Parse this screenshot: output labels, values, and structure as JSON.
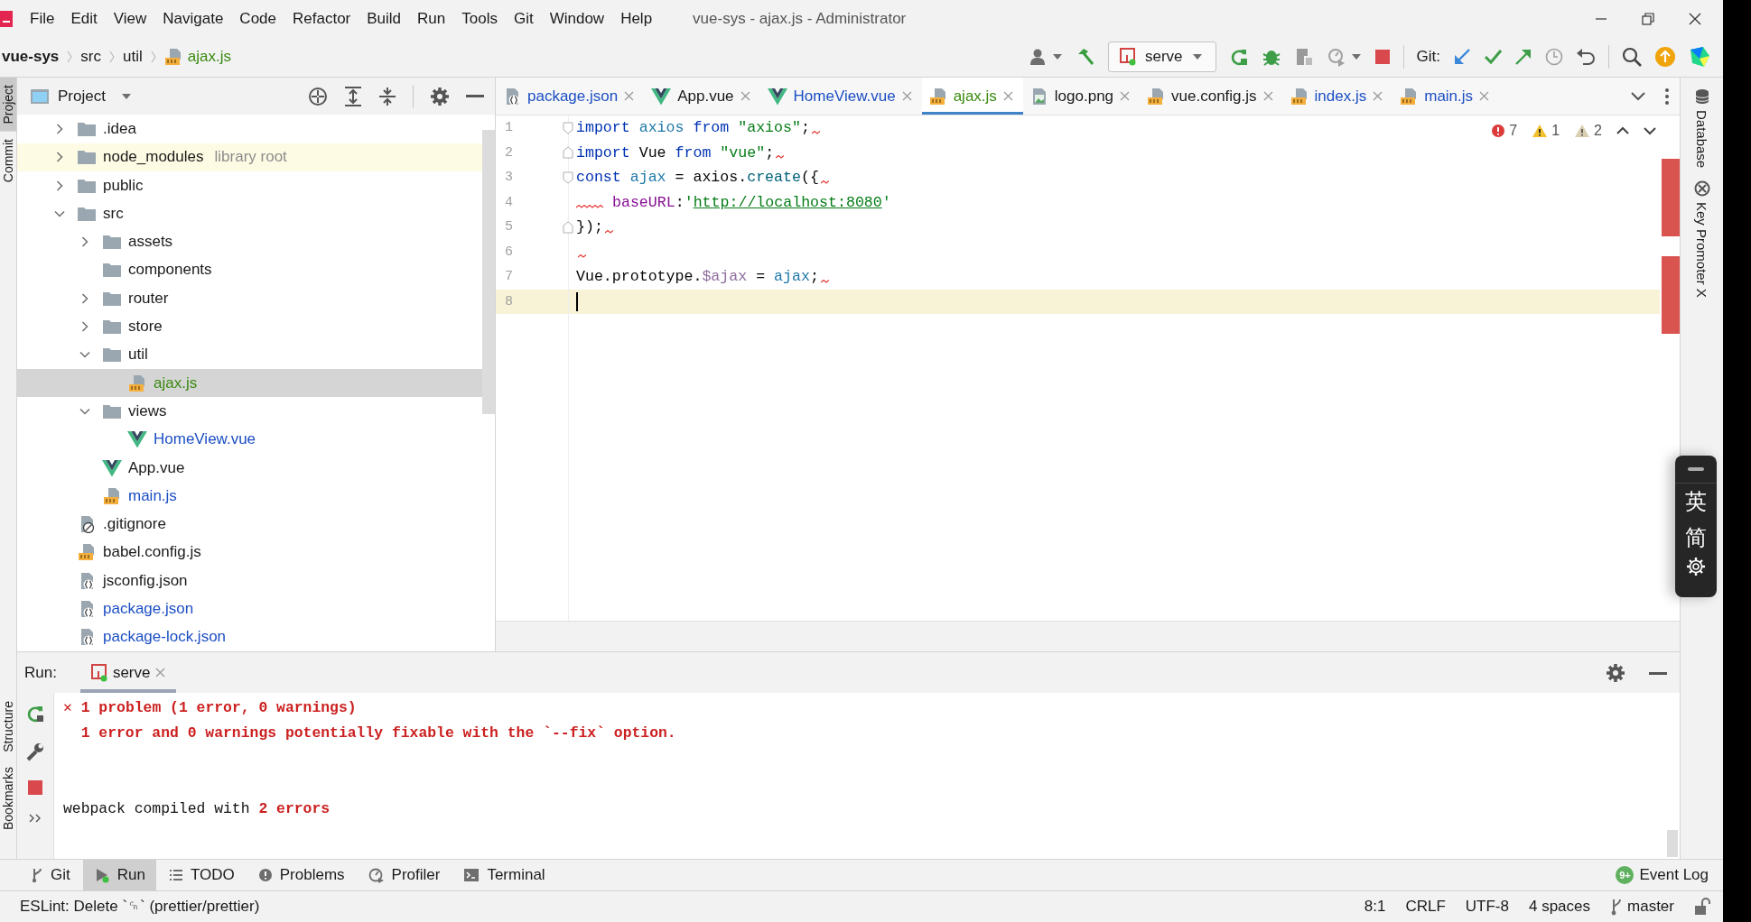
{
  "window": {
    "title": "vue-sys - ajax.js - Administrator"
  },
  "menu": [
    "File",
    "Edit",
    "View",
    "Navigate",
    "Code",
    "Refactor",
    "Build",
    "Run",
    "Tools",
    "Git",
    "Window",
    "Help"
  ],
  "breadcrumbs": [
    {
      "label": "vue-sys",
      "kind": "project"
    },
    {
      "label": "src",
      "kind": "folder"
    },
    {
      "label": "util",
      "kind": "folder"
    },
    {
      "label": "ajax.js",
      "kind": "js"
    }
  ],
  "toolbar": {
    "run_config": "serve",
    "git_label": "Git:"
  },
  "side_left": [
    {
      "label": "Project",
      "selected": true
    },
    {
      "label": "Commit",
      "selected": false
    },
    {
      "label": "Structure",
      "selected": false
    },
    {
      "label": "Bookmarks",
      "selected": false
    }
  ],
  "project_panel": {
    "title": "Project",
    "tree": [
      {
        "label": ".idea",
        "kind": "folder",
        "color": "#1a1a1a",
        "expanded": false,
        "selected": false
      },
      {
        "label": "node_modules",
        "hint": "library root",
        "kind": "library",
        "color": "#1a1a1a",
        "expanded": false,
        "selected": false
      },
      {
        "label": "public",
        "kind": "folder",
        "color": "#1a1a1a",
        "expanded": false,
        "selected": false
      },
      {
        "label": "src",
        "kind": "folder",
        "color": "#1a1a1a",
        "expanded": true,
        "selected": false,
        "children": [
          {
            "label": "assets",
            "kind": "folder",
            "color": "#1a1a1a",
            "expanded": false,
            "selected": false
          },
          {
            "label": "components",
            "kind": "folder",
            "color": "#1a1a1a",
            "selected": false
          },
          {
            "label": "router",
            "kind": "folder",
            "color": "#1a1a1a",
            "expanded": false,
            "selected": false
          },
          {
            "label": "store",
            "kind": "folder",
            "color": "#1a1a1a",
            "expanded": false,
            "selected": false
          },
          {
            "label": "util",
            "kind": "folder",
            "color": "#1a1a1a",
            "expanded": true,
            "selected": false,
            "children": [
              {
                "label": "ajax.js",
                "kind": "js",
                "color": "#3b8a12",
                "selected": true
              }
            ]
          },
          {
            "label": "views",
            "kind": "folder",
            "color": "#1a1a1a",
            "expanded": true,
            "selected": false,
            "children": [
              {
                "label": "HomeView.vue",
                "kind": "vue",
                "color": "#1c4fc4",
                "selected": false
              }
            ]
          },
          {
            "label": "App.vue",
            "kind": "vue",
            "color": "#1a1a1a",
            "selected": false
          },
          {
            "label": "main.js",
            "kind": "js",
            "color": "#1c4fc4",
            "selected": false
          }
        ]
      },
      {
        "label": ".gitignore",
        "kind": "ignore",
        "color": "#1a1a1a",
        "selected": false
      },
      {
        "label": "babel.config.js",
        "kind": "js",
        "color": "#1a1a1a",
        "selected": false
      },
      {
        "label": "jsconfig.json",
        "kind": "json",
        "color": "#1a1a1a",
        "selected": false
      },
      {
        "label": "package.json",
        "kind": "json",
        "color": "#1c4fc4",
        "selected": false
      },
      {
        "label": "package-lock.json",
        "kind": "json",
        "color": "#1c4fc4",
        "selected": false
      }
    ]
  },
  "editor": {
    "tabs": [
      {
        "label": "package.json",
        "kind": "json",
        "color": "#1c4fc4",
        "selected": false
      },
      {
        "label": "App.vue",
        "kind": "vue",
        "color": "#1a1a1a",
        "selected": false
      },
      {
        "label": "HomeView.vue",
        "kind": "vue",
        "color": "#1c4fc4",
        "selected": false
      },
      {
        "label": "ajax.js",
        "kind": "js",
        "color": "#3b8a12",
        "selected": true
      },
      {
        "label": "logo.png",
        "kind": "image",
        "color": "#1a1a1a",
        "selected": false
      },
      {
        "label": "vue.config.js",
        "kind": "js",
        "color": "#1a1a1a",
        "selected": false
      },
      {
        "label": "index.js",
        "kind": "js",
        "color": "#1c4fc4",
        "selected": false
      },
      {
        "label": "main.js",
        "kind": "js",
        "color": "#1c4fc4",
        "selected": false
      }
    ],
    "inspections": [
      {
        "kind": "error",
        "count": "7"
      },
      {
        "kind": "warning",
        "count": "1"
      },
      {
        "kind": "weak",
        "count": "2"
      }
    ],
    "lines": [
      {
        "number": "1",
        "fold_start": true,
        "fold_end": false,
        "lint_start": false,
        "lint_end": true,
        "current": false,
        "tokens": [
          {
            "text": "import ",
            "kind": "keyword"
          },
          {
            "text": "axios",
            "kind": "var"
          },
          {
            "text": " from ",
            "kind": "keyword"
          },
          {
            "text": "\"axios\"",
            "kind": "string"
          },
          {
            "text": ";",
            "kind": "plain"
          }
        ]
      },
      {
        "number": "2",
        "fold_start": false,
        "fold_end": true,
        "lint_start": false,
        "lint_end": true,
        "current": false,
        "tokens": [
          {
            "text": "import ",
            "kind": "keyword"
          },
          {
            "text": "Vue",
            "kind": "plain"
          },
          {
            "text": " from ",
            "kind": "keyword"
          },
          {
            "text": "\"vue\"",
            "kind": "string"
          },
          {
            "text": ";",
            "kind": "plain"
          }
        ]
      },
      {
        "number": "3",
        "fold_start": true,
        "fold_end": false,
        "lint_start": false,
        "lint_end": true,
        "current": false,
        "tokens": [
          {
            "text": "const ",
            "kind": "keyword"
          },
          {
            "text": "ajax",
            "kind": "var"
          },
          {
            "text": " = axios.",
            "kind": "plain"
          },
          {
            "text": "create",
            "kind": "fn"
          },
          {
            "text": "({",
            "kind": "plain"
          }
        ]
      },
      {
        "number": "4",
        "fold_start": false,
        "fold_end": false,
        "lint_start": true,
        "lint_end": false,
        "current": false,
        "tokens": [
          {
            "text": "baseURL",
            "kind": "prop"
          },
          {
            "text": ":",
            "kind": "plain"
          },
          {
            "text": "'",
            "kind": "string"
          },
          {
            "text": "http://localhost:8080",
            "kind": "url"
          },
          {
            "text": "'",
            "kind": "string"
          }
        ]
      },
      {
        "number": "5",
        "fold_start": false,
        "fold_end": true,
        "lint_start": false,
        "lint_end": true,
        "current": false,
        "tokens": [
          {
            "text": "});",
            "kind": "plain"
          }
        ]
      },
      {
        "number": "6",
        "fold_start": false,
        "fold_end": false,
        "lint_start": false,
        "lint_end": true,
        "current": false
      },
      {
        "number": "7",
        "fold_start": false,
        "fold_end": false,
        "lint_start": false,
        "lint_end": true,
        "current": false,
        "tokens": [
          {
            "text": "Vue.prototype.",
            "kind": "plain"
          },
          {
            "text": "$ajax",
            "kind": "member"
          },
          {
            "text": " = ",
            "kind": "plain"
          },
          {
            "text": "ajax",
            "kind": "var"
          },
          {
            "text": ";",
            "kind": "plain"
          }
        ]
      },
      {
        "number": "8",
        "fold_start": false,
        "fold_end": false,
        "lint_start": false,
        "lint_end": false,
        "current": true
      }
    ]
  },
  "side_right": [
    {
      "label": "Database",
      "kind": "database"
    },
    {
      "label": "Key Promoter X",
      "kind": "promoter"
    }
  ],
  "run_panel": {
    "label": "Run:",
    "tabs": [
      {
        "label": "serve",
        "selected": true
      }
    ],
    "console": [
      {
        "kind": "text",
        "segments": [
          {
            "text": "✕",
            "kind": "error"
          },
          {
            "text": " 1 problem (1 error, 0 warnings)",
            "kind": "error"
          }
        ]
      },
      {
        "kind": "text",
        "segments": [
          {
            "text": "  1 error and 0 warnings potentially fixable with the `--fix` option.",
            "kind": "error"
          }
        ]
      },
      {
        "kind": "blank"
      },
      {
        "kind": "blank"
      },
      {
        "kind": "text",
        "segments": [
          {
            "text": "webpack compiled with ",
            "kind": "plain"
          },
          {
            "text": "2 errors",
            "kind": "error"
          }
        ]
      }
    ]
  },
  "tool_windows": [
    {
      "label": "Git",
      "kind": "branch",
      "selected": false
    },
    {
      "label": "Run",
      "kind": "run",
      "selected": true
    },
    {
      "label": "TODO",
      "kind": "list",
      "selected": false
    },
    {
      "label": "Problems",
      "kind": "problems",
      "selected": false
    },
    {
      "label": "Profiler",
      "kind": "profiler",
      "selected": false
    },
    {
      "label": "Terminal",
      "kind": "terminal",
      "selected": false
    }
  ],
  "event_log": {
    "label": "Event Log",
    "badge": "9+"
  },
  "status_bar": {
    "message": "ESLint: Delete `␍` (prettier/prettier)",
    "items": [
      "8:1",
      "CRLF",
      "UTF-8",
      "4 spaces"
    ],
    "branch": "master"
  },
  "ime": [
    "英",
    "简"
  ]
}
